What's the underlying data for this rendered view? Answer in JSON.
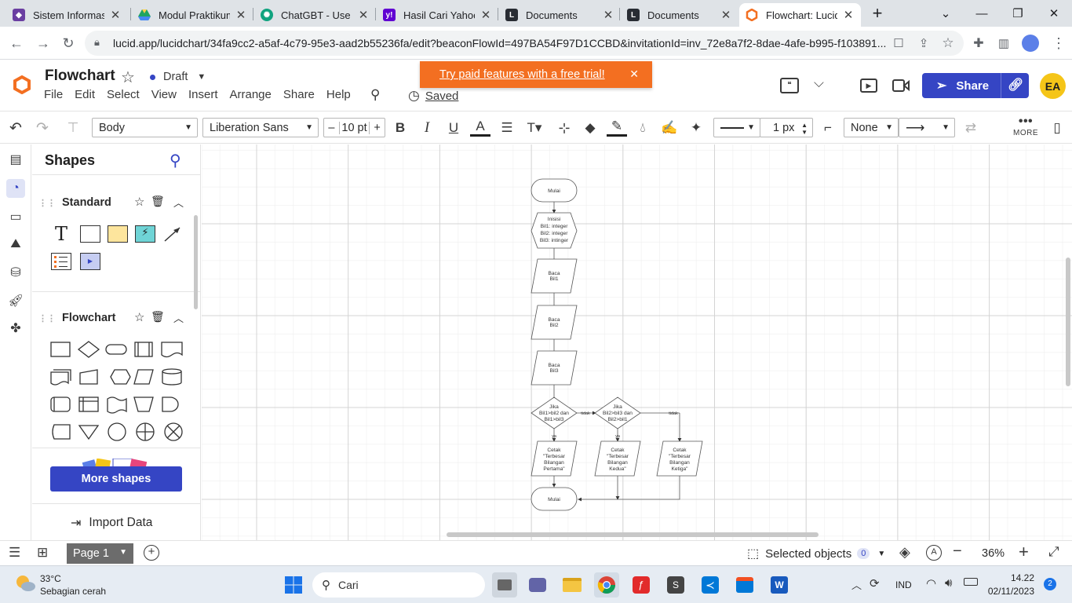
{
  "browser": {
    "tabs": [
      {
        "title": "Sistem Informasi",
        "icon": "ecampus-icon",
        "color": "#6a3ea1",
        "active": false
      },
      {
        "title": "Modul Praktikum",
        "icon": "google-drive-icon",
        "color": "#1fa463",
        "active": false
      },
      {
        "title": "ChatGBT - Use U",
        "icon": "chatgpt-icon",
        "color": "#10a37f",
        "active": false
      },
      {
        "title": "Hasil Cari Yahoo",
        "icon": "yahoo-icon",
        "color": "#6001d2",
        "active": false
      },
      {
        "title": "Documents",
        "icon": "lucid-icon",
        "color": "#282c33",
        "active": false
      },
      {
        "title": "Documents",
        "icon": "lucid-icon",
        "color": "#282c33",
        "active": false
      },
      {
        "title": "Flowchart: Lucid",
        "icon": "lucidchart-icon",
        "color": "#f36f21",
        "active": true
      }
    ],
    "url": "lucid.app/lucidchart/34fa9cc2-a5af-4c79-95e3-aad2b55236fa/edit?beaconFlowId=497BA54F97D1CCBD&invitationId=inv_72e8a7f2-8dae-4afe-b995-f103891..."
  },
  "app": {
    "title": "Flowchart",
    "status": "Draft",
    "saved": "Saved",
    "menu": [
      "File",
      "Edit",
      "Select",
      "View",
      "Insert",
      "Arrange",
      "Share",
      "Help"
    ],
    "banner": "Try paid features with a free trial!",
    "share_label": "Share",
    "avatar": "EA",
    "brand_color": "#f36f21",
    "share_color": "#3545c4"
  },
  "toolbar": {
    "style": "Body",
    "font": "Liberation Sans",
    "font_size": "10 pt",
    "minus": "–",
    "plus": "+",
    "bold": "B",
    "italic": "I",
    "underline": "U",
    "text_color": "A",
    "line_width": "1 px",
    "endpoint": "None",
    "more": "MORE"
  },
  "shapes_panel": {
    "title": "Shapes",
    "standard": "Standard",
    "flowchart": "Flowchart",
    "more_shapes": "More shapes",
    "import_data": "Import Data"
  },
  "flowchart": {
    "start": "Mulai",
    "init": [
      "Inisisi",
      "Bil1: integer",
      "Bil2: integer",
      "Bil3: intinger"
    ],
    "read1": [
      "Baca",
      "Bil1"
    ],
    "read2": [
      "Baca",
      "Bil2"
    ],
    "read3": [
      "Baca",
      "Bil3"
    ],
    "cond1": [
      "Jika",
      "Bil1>bil2 dan",
      "Bil1>bil3"
    ],
    "cond2": [
      "Jika",
      "Bil2>bil3 dan",
      "Bil2>bil1"
    ],
    "no1": "tidak",
    "no2": "tidak",
    "yes1": "ya",
    "yes2": "ya",
    "out1": [
      "Cetak",
      "\"Terbesar",
      "Bilangan",
      "Pertama\""
    ],
    "out2": [
      "Cetak",
      "\"Terbesar",
      "Bilangan",
      "Kedua\""
    ],
    "out3": [
      "Cetak",
      "\"Terbesar",
      "Bilangan",
      "Ketiga\""
    ],
    "end": "Mulai"
  },
  "bottom": {
    "page": "Page 1",
    "selected": "Selected objects",
    "selected_count": "0",
    "zoom": "36%",
    "minus": "−",
    "plus": "+"
  },
  "taskbar": {
    "temp": "33°C",
    "weather": "Sebagian cerah",
    "search": "Cari",
    "lang": "IND",
    "time": "14.22",
    "date": "02/11/2023",
    "notif": "2"
  }
}
